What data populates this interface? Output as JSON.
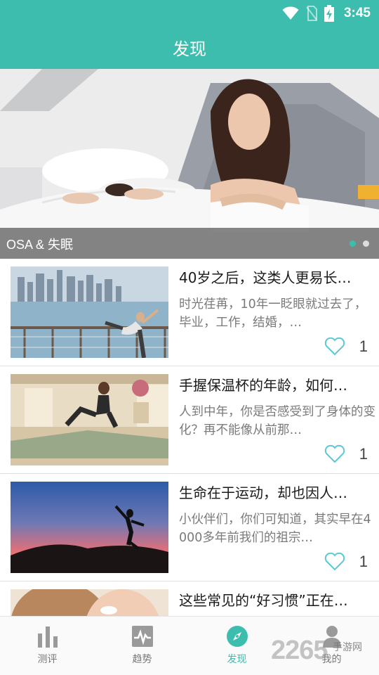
{
  "status_bar": {
    "time": "3:45",
    "icons": [
      "wifi-icon",
      "no-sim-icon",
      "battery-charging-icon"
    ]
  },
  "header": {
    "title": "发现"
  },
  "banner": {
    "caption": "OSA & 失眠",
    "dots": 2,
    "active_dot": 0
  },
  "articles": [
    {
      "title": "40岁之后，这类人更易长…",
      "summary": "时光荏苒，10年一眨眼就过去了，毕业，工作，结婚，…",
      "likes": "1"
    },
    {
      "title": "手握保温杯的年龄，如何…",
      "summary": "人到中年，你是否感受到了身体的变化？再不能像从前那…",
      "likes": "1"
    },
    {
      "title": "生命在于运动，却也因人…",
      "summary": "小伙伴们，你们可知道，其实早在4000多年前我们的祖宗…",
      "likes": "1"
    },
    {
      "title": "这些常见的“好习惯”正在…",
      "summary": "",
      "likes": ""
    }
  ],
  "bottom_nav": [
    {
      "label": "测评",
      "icon": "bar-chart-icon",
      "active": false
    },
    {
      "label": "趋势",
      "icon": "trend-icon",
      "active": false
    },
    {
      "label": "发现",
      "icon": "compass-icon",
      "active": true
    },
    {
      "label": "我的",
      "icon": "person-icon",
      "active": false
    }
  ],
  "watermark": {
    "number": "2265",
    "site": "手游网",
    "url": ""
  },
  "colors": {
    "primary": "#3dbdad",
    "heart": "#5bc8d4"
  }
}
